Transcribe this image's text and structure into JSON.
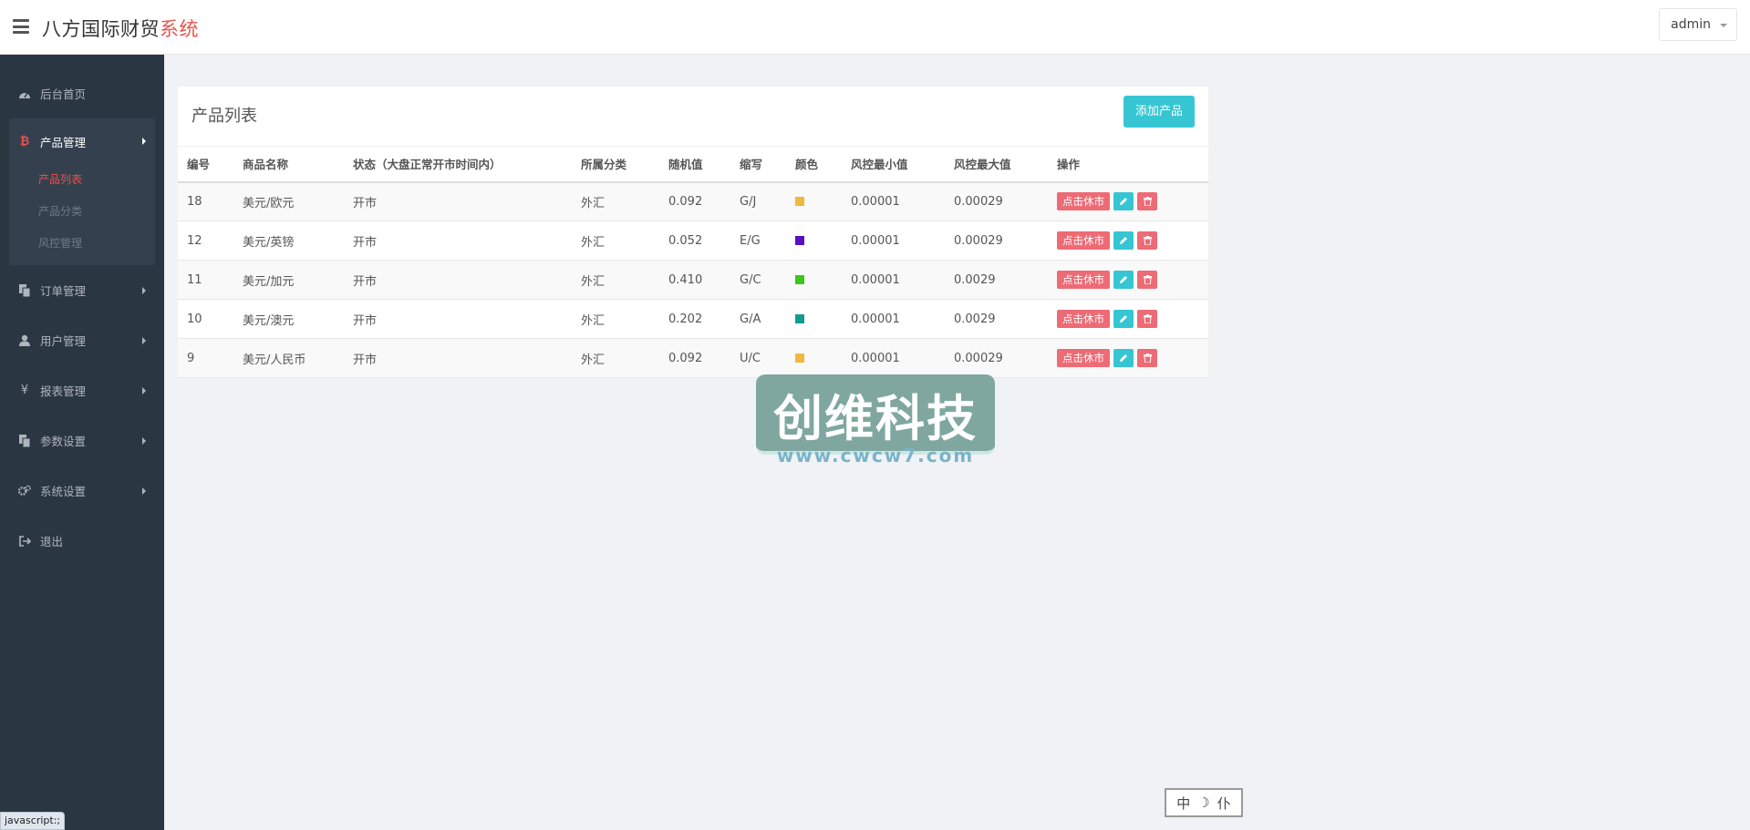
{
  "brand": {
    "main": "八方国际财贸",
    "accent": "系统"
  },
  "user": {
    "name": "admin"
  },
  "sidebar": {
    "items": [
      {
        "label": "后台首页",
        "icon": "dashboard-icon"
      },
      {
        "label": "产品管理",
        "icon": "bitcoin-icon",
        "children": [
          "产品列表",
          "产品分类",
          "风控管理"
        ]
      },
      {
        "label": "订单管理",
        "icon": "files-icon"
      },
      {
        "label": "用户管理",
        "icon": "user-icon"
      },
      {
        "label": "报表管理",
        "icon": "yen-icon"
      },
      {
        "label": "参数设置",
        "icon": "files-icon"
      },
      {
        "label": "系统设置",
        "icon": "gears-icon"
      },
      {
        "label": "退出",
        "icon": "signout-icon"
      }
    ]
  },
  "panel": {
    "title": "产品列表",
    "add_label": "添加产品"
  },
  "table": {
    "headers": [
      "编号",
      "商品名称",
      "状态（大盘正常开市时间内）",
      "所属分类",
      "随机值",
      "缩写",
      "颜色",
      "风控最小值",
      "风控最大值",
      "操作"
    ],
    "rows": [
      {
        "id": "18",
        "name": "美元/欧元",
        "status": "开市",
        "category": "外汇",
        "random": "0.092",
        "abbr": "G/J",
        "color": "#f0b840",
        "min": "0.00001",
        "max": "0.00029",
        "action": "点击休市"
      },
      {
        "id": "12",
        "name": "美元/英镑",
        "status": "开市",
        "category": "外汇",
        "random": "0.052",
        "abbr": "E/G",
        "color": "#5a0fbf",
        "min": "0.00001",
        "max": "0.00029",
        "action": "点击休市"
      },
      {
        "id": "11",
        "name": "美元/加元",
        "status": "开市",
        "category": "外汇",
        "random": "0.410",
        "abbr": "G/C",
        "color": "#3cc61a",
        "min": "0.00001",
        "max": "0.0029",
        "action": "点击休市"
      },
      {
        "id": "10",
        "name": "美元/澳元",
        "status": "开市",
        "category": "外汇",
        "random": "0.202",
        "abbr": "G/A",
        "color": "#129a93",
        "min": "0.00001",
        "max": "0.0029",
        "action": "点击休市"
      },
      {
        "id": "9",
        "name": "美元/人民币",
        "status": "开市",
        "category": "外汇",
        "random": "0.092",
        "abbr": "U/C",
        "color": "#f0b840",
        "min": "0.00001",
        "max": "0.00029",
        "action": "点击休市"
      }
    ]
  },
  "watermark": {
    "title": "创维科技",
    "url": "www.cwcw7.com"
  },
  "ime": {
    "lang": "中",
    "moon": "☽",
    "mode": "仆"
  },
  "status_bar": {
    "text": "javascript:;"
  }
}
